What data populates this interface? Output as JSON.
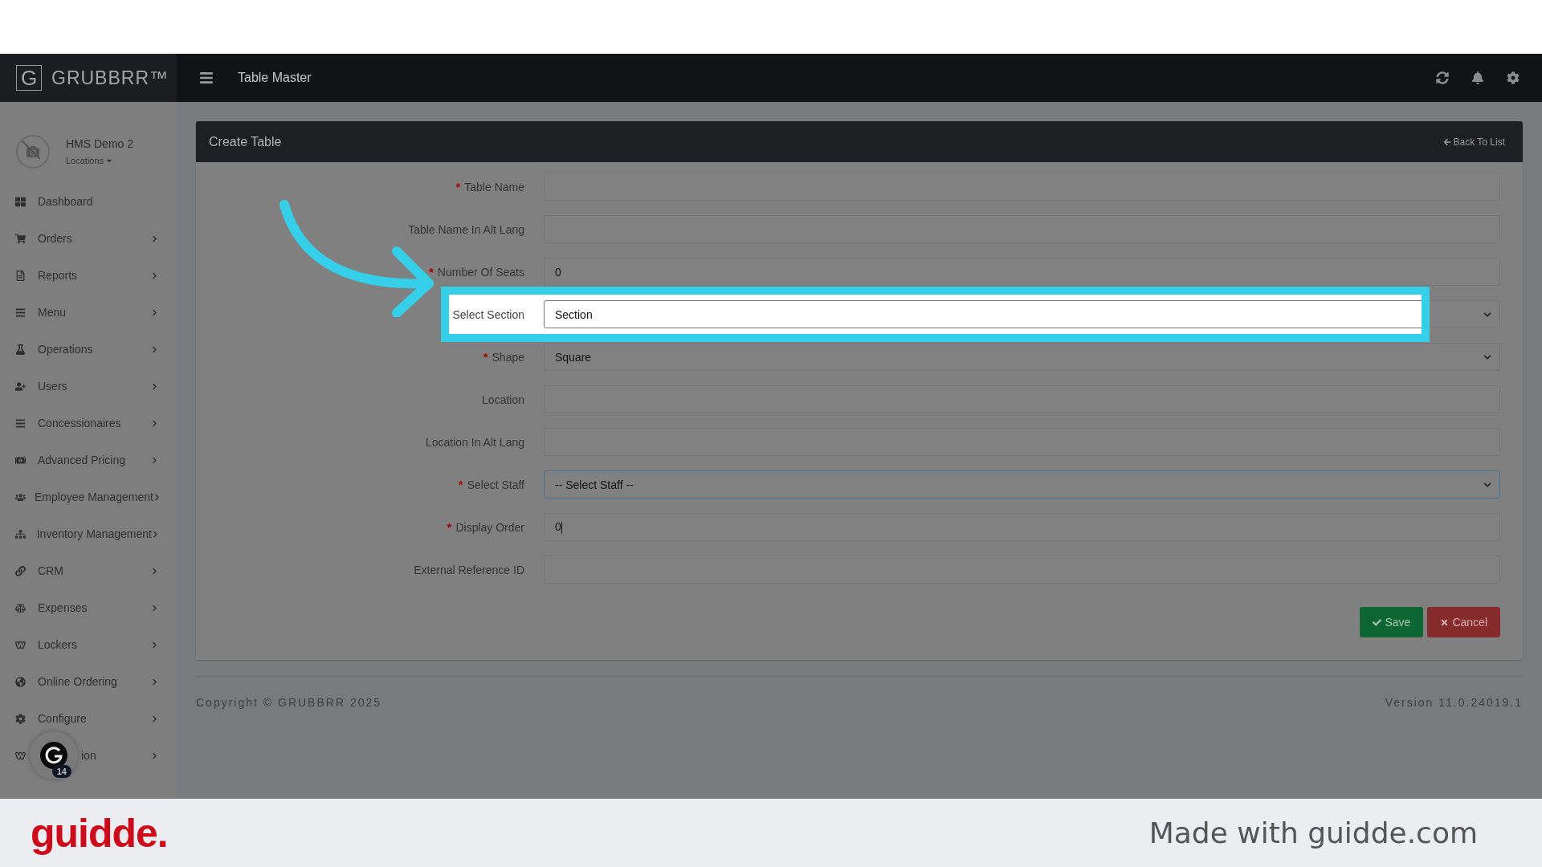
{
  "logo": {
    "mark": "G",
    "name": "GRUBBRR™"
  },
  "top_bar": {
    "title": "Table Master"
  },
  "profile": {
    "name": "HMS Demo 2",
    "locations": "Locations"
  },
  "sidebar": {
    "items": [
      {
        "label": "Dashboard",
        "has_submenu": false
      },
      {
        "label": "Orders",
        "has_submenu": true
      },
      {
        "label": "Reports",
        "has_submenu": true
      },
      {
        "label": "Menu",
        "has_submenu": true
      },
      {
        "label": "Operations",
        "has_submenu": true
      },
      {
        "label": "Users",
        "has_submenu": true
      },
      {
        "label": "Concessionaires",
        "has_submenu": true
      },
      {
        "label": "Advanced Pricing",
        "has_submenu": true
      },
      {
        "label": "Employee Management",
        "has_submenu": true
      },
      {
        "label": "Inventory Management",
        "has_submenu": true
      },
      {
        "label": "CRM",
        "has_submenu": true
      },
      {
        "label": "Expenses",
        "has_submenu": true
      },
      {
        "label": "Lockers",
        "has_submenu": true
      },
      {
        "label": "Online Ordering",
        "has_submenu": true
      },
      {
        "label": "Configure",
        "has_submenu": true
      },
      {
        "label": "ion",
        "has_submenu": true,
        "badge_count": "14"
      }
    ]
  },
  "card": {
    "title": "Create Table",
    "back_link": "Back To List"
  },
  "fields": [
    {
      "label": "Table Name",
      "mark": "*",
      "kind": "text",
      "focused": false,
      "highlighted": false
    },
    {
      "label": "Table Name In Alt Lang",
      "kind": "text",
      "focused": false,
      "highlighted": false
    },
    {
      "label": "Number Of Seats",
      "mark": "*",
      "kind": "text",
      "value": "0",
      "focused": false,
      "highlighted": false
    },
    {
      "label": "Select Section",
      "kind": "select",
      "value": "Section",
      "focused": false,
      "highlighted": true
    },
    {
      "label": "Shape",
      "mark": "*",
      "kind": "select",
      "value": "Square",
      "focused": false,
      "highlighted": false
    },
    {
      "label": "Location",
      "kind": "text",
      "focused": false,
      "highlighted": false
    },
    {
      "label": "Location In Alt Lang",
      "kind": "text",
      "focused": false,
      "highlighted": false
    },
    {
      "label": "Select Staff",
      "mark": "*",
      "kind": "select",
      "value": "-- Select Staff --",
      "focused": true,
      "highlighted": false
    },
    {
      "label": "Display Order",
      "mark": "*",
      "kind": "text",
      "value": "0",
      "focused": false,
      "highlighted": false,
      "caret": true
    },
    {
      "label": "External Reference ID",
      "kind": "text",
      "focused": false,
      "highlighted": false
    }
  ],
  "buttons": [
    {
      "label": "Save",
      "kind": "save"
    },
    {
      "label": "Cancel",
      "kind": "cancel"
    }
  ],
  "footer": {
    "copyright": "Copyright © GRUBBRR 2025",
    "version": "Version 11.0.24019.1"
  },
  "branding": {
    "logo": "guidde.",
    "tagline": "Made with guidde.com"
  }
}
